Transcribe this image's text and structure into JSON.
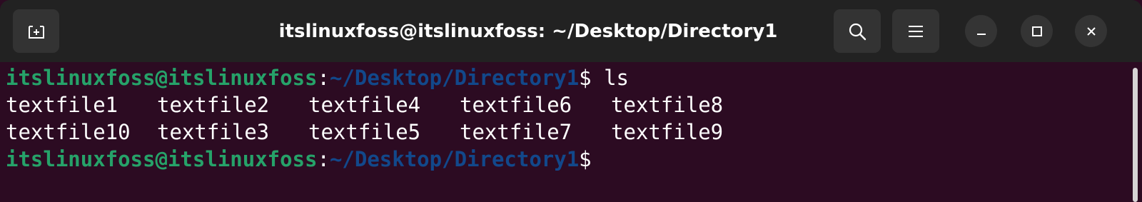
{
  "window": {
    "title": "itslinuxfoss@itslinuxfoss: ~/Desktop/Directory1"
  },
  "titlebar_buttons": {
    "new_tab_icon": "new-tab-icon",
    "search_icon": "search-icon",
    "menu_icon": "hamburger-menu-icon",
    "minimize_icon": "minimize-icon",
    "maximize_icon": "maximize-icon",
    "close_icon": "close-icon"
  },
  "terminal": {
    "prompt_user": "itslinuxfoss@itslinuxfoss",
    "prompt_sep": ":",
    "prompt_path": "~/Desktop/Directory1",
    "prompt_dollar": "$",
    "command": " ls",
    "files_row1": [
      "textfile1",
      "textfile2",
      "textfile4",
      "textfile6",
      "textfile8"
    ],
    "files_row2": [
      "textfile10",
      "textfile3",
      "textfile5",
      "textfile7",
      "textfile9"
    ]
  },
  "colors": {
    "terminal_bg": "#2c0b22",
    "titlebar_bg": "#222222",
    "prompt_user": "#26a269",
    "prompt_path": "#12488b",
    "text": "#ffffff"
  }
}
